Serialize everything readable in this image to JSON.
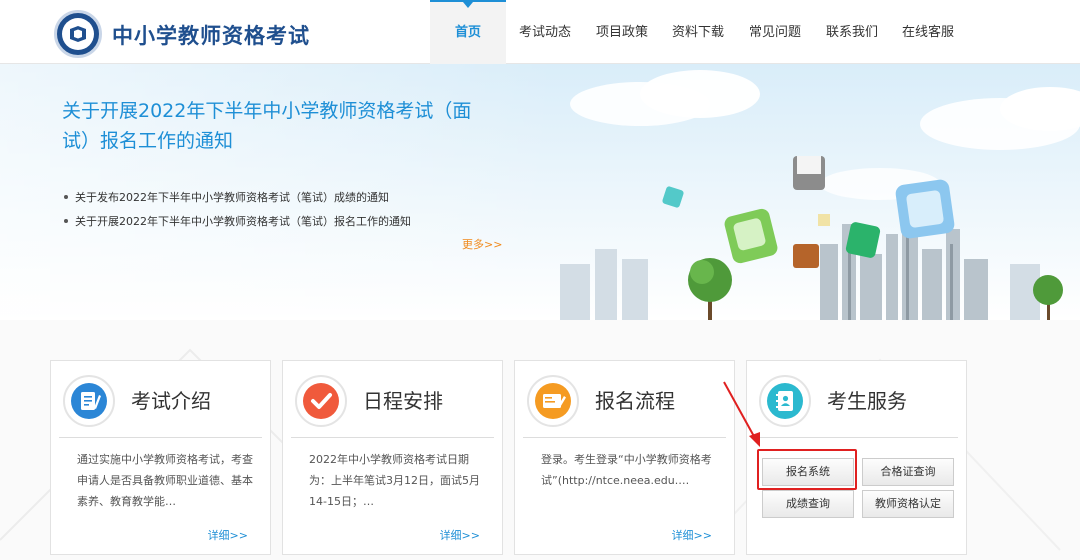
{
  "header": {
    "site_title": "中小学教师资格考试",
    "nav": [
      {
        "label": "首页",
        "active": true
      },
      {
        "label": "考试动态"
      },
      {
        "label": "项目政策"
      },
      {
        "label": "资料下载"
      },
      {
        "label": "常见问题"
      },
      {
        "label": "联系我们"
      },
      {
        "label": "在线客服"
      }
    ]
  },
  "banner": {
    "headline": "关于开展2022年下半年中小学教师资格考试（面试）报名工作的通知",
    "news": [
      "关于发布2022年下半年中小学教师资格考试（笔试）成绩的通知",
      "关于开展2022年下半年中小学教师资格考试（笔试）报名工作的通知"
    ],
    "more": "更多>>"
  },
  "cards": [
    {
      "title": "考试介绍",
      "text": "通过实施中小学教师资格考试，考查申请人是否具备教师职业道德、基本素养、教育教学能…",
      "more": "详细>>"
    },
    {
      "title": "日程安排",
      "text": "2022年中小学教师资格考试日期为：上半年笔试3月12日，面试5月14-15日；…",
      "more": "详细>>"
    },
    {
      "title": "报名流程",
      "text": "登录。考生登录“中小学教师资格考试”(http://ntce.neea.edu.…",
      "more": "详细>>"
    },
    {
      "title": "考生服务"
    }
  ],
  "services": {
    "register": "报名系统",
    "certificate_query": "合格证查询",
    "score_query": "成绩查询",
    "qualification": "教师资格认定"
  },
  "colors": {
    "brand": "#1f4f8e",
    "accent": "#1e8fd6",
    "more": "#f08a1c",
    "annotation": "#e02020"
  },
  "icons": {
    "card1": "document-pen-icon",
    "card2": "checkmark-icon",
    "card3": "form-pen-icon",
    "card4": "contact-book-icon"
  }
}
